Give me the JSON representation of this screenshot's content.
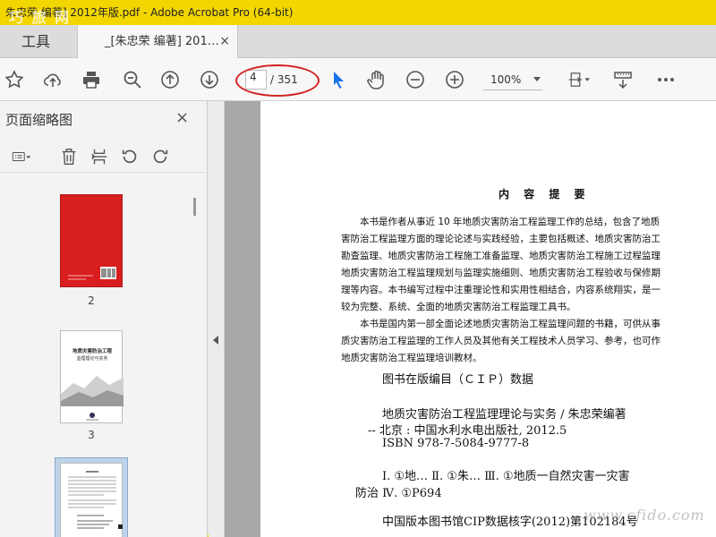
{
  "window": {
    "title": "朱忠荣 编著] 2012年版.pdf - Adobe Acrobat Pro (64-bit)",
    "watermark": "巧 旅 网"
  },
  "tabs": {
    "tools_label": "工具",
    "doc_label": "_[朱忠荣 编著] 201…",
    "close_glyph": "×"
  },
  "toolbar": {
    "page_current": "4",
    "page_total": "/ 351",
    "zoom": "100%",
    "icons": [
      "star-icon",
      "cloud-upload-icon",
      "print-icon",
      "zoom-search-icon",
      "page-up-icon",
      "page-down-icon",
      "select-arrow-icon",
      "hand-icon",
      "zoom-out-icon",
      "zoom-in-icon",
      "fit-page-icon",
      "scroll-mode-icon",
      "more-icon"
    ],
    "accent": "#1a73e8"
  },
  "sidebar": {
    "title": "页面缩略图",
    "close_glyph": "×",
    "thumbnails": [
      {
        "label": "2"
      },
      {
        "label": "3"
      },
      {
        "label": ""
      }
    ],
    "thumb_cover_color": "#d81e1e",
    "thumb3_title": "地质灾害防治工程",
    "thumb3_subtitle": "监理理论与实务"
  },
  "document": {
    "heading": "内 容 提 要",
    "summary_lines": [
      "　　本书是作者从事近 10 年地质灾害防治工程监理工作的总结，包含了地质",
      "害防治工程监理方面的理论论述与实践经验，主要包括概述、地质灾害防治工",
      "勘查监理、地质灾害防治工程施工准备监理、地质灾害防治工程施工过程监理",
      "地质灾害防治工程监理规划与监理实施细则、地质灾害防治工程验收与保修期",
      "理等内容。本书编写过程中注重理论性和实用性相结合，内容系统翔实，是一",
      "较为完整、系统、全面的地质灾害防治工程监理工具书。",
      "　　本书是国内第一部全面论述地质灾害防治工程监理问题的书籍，可供从事",
      "质灾害防治工程监理的工作人员及其他有关工程技术人员学习、参考，也可作",
      "地质灾害防治工程监理培训教材。"
    ],
    "cip_title": "图书在版编目（ＣＩＰ）数据",
    "cip_lines": [
      "地质灾害防治工程监理理论与实务 / 朱忠荣编著",
      "-- 北京 : 中国水利水电出版社, 2012.5",
      "ISBN 978-7-5084-9777-8",
      "Ⅰ. ①地…  Ⅱ. ①朱…  Ⅲ. ①地质一自然灾害一灾害",
      "防治  Ⅳ. ①P694",
      "中国版本图书馆CIP数据核字(2012)第102184号"
    ]
  },
  "watermark_bottom": "www.cfido.com"
}
